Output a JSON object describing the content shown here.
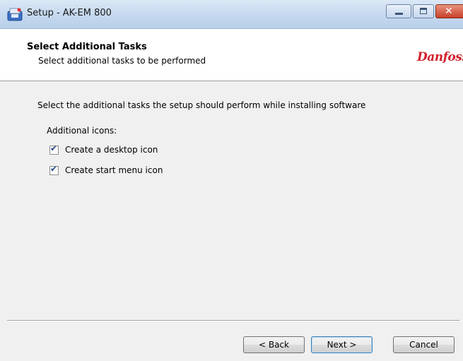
{
  "window": {
    "title": "Setup - AK-EM 800",
    "app_icon": "installer-icon",
    "buttons": {
      "minimize": "minimize-icon",
      "maximize": "maximize-icon",
      "close": "close-icon",
      "close_glyph": "✕"
    }
  },
  "header": {
    "title": "Select Additional Tasks",
    "subtitle": "Select additional tasks to be performed",
    "logo_text": "Danfoss"
  },
  "body": {
    "instruction": "Select the additional tasks the setup should perform while installing software",
    "group_label": "Additional icons:",
    "tasks": [
      {
        "label": "Create a desktop icon",
        "checked": true
      },
      {
        "label": "Create start menu icon",
        "checked": true
      }
    ]
  },
  "footer": {
    "back_label": "< Back",
    "next_label": "Next >",
    "cancel_label": "Cancel"
  },
  "colors": {
    "logo": "#d2222d",
    "checkmark": "#2b4a8c",
    "close_button": "#c7412a"
  }
}
